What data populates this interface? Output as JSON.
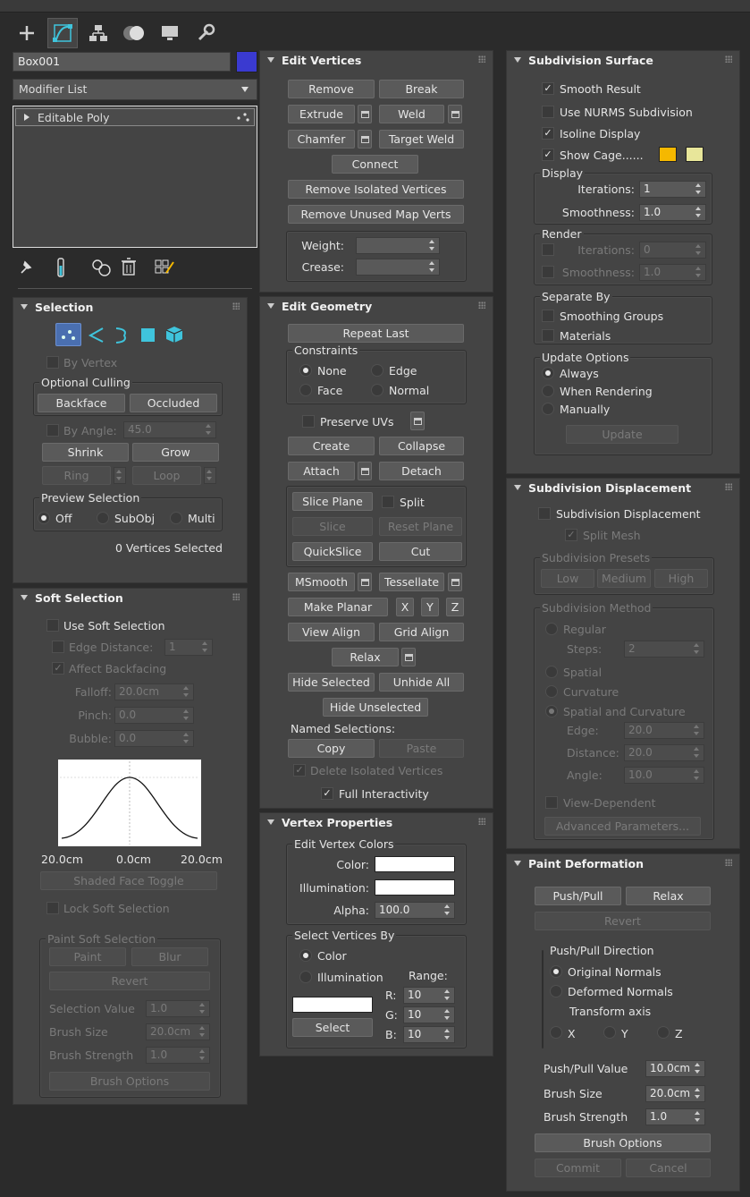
{
  "tabs": [
    {
      "name": "create-tab",
      "icon": "plus-icon"
    },
    {
      "name": "modify-tab",
      "icon": "modify-icon"
    },
    {
      "name": "hierarchy-tab",
      "icon": "hierarchy-icon"
    },
    {
      "name": "motion-tab",
      "icon": "motion-icon"
    },
    {
      "name": "display-tab",
      "icon": "display-icon"
    },
    {
      "name": "utilities-tab",
      "icon": "wrench-icon"
    }
  ],
  "object": {
    "name": "Box001",
    "color": "#3a3ad0"
  },
  "modifier_list": {
    "label": "Modifier List",
    "stack_item": "Editable Poly"
  },
  "selection": {
    "title": "Selection",
    "by_vertex": "By Vertex",
    "optional_culling": "Optional Culling",
    "backface": "Backface",
    "occluded": "Occluded",
    "by_angle": "By Angle:",
    "angle_value": "45.0",
    "shrink": "Shrink",
    "grow": "Grow",
    "ring": "Ring",
    "loop": "Loop",
    "preview_selection": "Preview Selection",
    "off": "Off",
    "subobj": "SubObj",
    "multi": "Multi",
    "status": "0 Vertices Selected"
  },
  "soft_selection": {
    "title": "Soft Selection",
    "use_soft": "Use Soft Selection",
    "edge_distance": "Edge Distance:",
    "edge_distance_value": "1",
    "affect_backfacing": "Affect Backfacing",
    "falloff": "Falloff:",
    "falloff_value": "20.0cm",
    "pinch": "Pinch:",
    "pinch_value": "0.0",
    "bubble": "Bubble:",
    "bubble_value": "0.0",
    "curve_left": "20.0cm",
    "curve_mid": "0.0cm",
    "curve_right": "20.0cm",
    "shaded_face_toggle": "Shaded Face Toggle",
    "lock_soft": "Lock Soft Selection",
    "paint_soft": "Paint Soft Selection",
    "paint": "Paint",
    "blur": "Blur",
    "revert": "Revert",
    "selection_value": "Selection Value",
    "selection_value_v": "1.0",
    "brush_size": "Brush Size",
    "brush_size_v": "20.0cm",
    "brush_strength": "Brush Strength",
    "brush_strength_v": "1.0",
    "brush_options": "Brush Options"
  },
  "edit_vertices": {
    "title": "Edit Vertices",
    "remove": "Remove",
    "break": "Break",
    "extrude": "Extrude",
    "weld": "Weld",
    "chamfer": "Chamfer",
    "target_weld": "Target Weld",
    "connect": "Connect",
    "remove_isolated": "Remove Isolated Vertices",
    "remove_unused": "Remove Unused Map Verts",
    "weight": "Weight:",
    "crease": "Crease:"
  },
  "edit_geometry": {
    "title": "Edit Geometry",
    "repeat_last": "Repeat Last",
    "constraints": "Constraints",
    "none": "None",
    "edge": "Edge",
    "face": "Face",
    "normal": "Normal",
    "preserve_uvs": "Preserve UVs",
    "create": "Create",
    "collapse": "Collapse",
    "attach": "Attach",
    "detach": "Detach",
    "slice_plane": "Slice Plane",
    "split": "Split",
    "slice": "Slice",
    "reset_plane": "Reset Plane",
    "quickslice": "QuickSlice",
    "cut": "Cut",
    "msmooth": "MSmooth",
    "tessellate": "Tessellate",
    "make_planar": "Make Planar",
    "x": "X",
    "y": "Y",
    "z": "Z",
    "view_align": "View Align",
    "grid_align": "Grid Align",
    "relax": "Relax",
    "hide_selected": "Hide Selected",
    "unhide_all": "Unhide All",
    "hide_unselected": "Hide Unselected",
    "named_selections": "Named Selections:",
    "copy": "Copy",
    "paste": "Paste",
    "delete_isolated": "Delete Isolated Vertices",
    "full_interactivity": "Full Interactivity"
  },
  "vertex_properties": {
    "title": "Vertex Properties",
    "edit_vertex_colors": "Edit Vertex Colors",
    "color": "Color:",
    "illumination": "Illumination:",
    "alpha": "Alpha:",
    "alpha_value": "100.0",
    "select_vertices_by": "Select Vertices By",
    "color_opt": "Color",
    "illumination_opt": "Illumination",
    "range": "Range:",
    "r": "R:",
    "g": "G:",
    "b": "B:",
    "r_v": "10",
    "g_v": "10",
    "b_v": "10",
    "select": "Select"
  },
  "subdivision_surface": {
    "title": "Subdivision Surface",
    "smooth_result": "Smooth Result",
    "use_nurms": "Use NURMS Subdivision",
    "isoline_display": "Isoline Display",
    "show_cage": "Show Cage......",
    "cage_color1": "#f5b800",
    "cage_color2": "#e8e69a",
    "display": "Display",
    "iterations": "Iterations:",
    "iterations_v": "1",
    "smoothness": "Smoothness:",
    "smoothness_v": "1.0",
    "render": "Render",
    "r_iterations_v": "0",
    "r_smoothness_v": "1.0",
    "separate_by": "Separate By",
    "smoothing_groups": "Smoothing Groups",
    "materials": "Materials",
    "update_options": "Update Options",
    "always": "Always",
    "when_rendering": "When Rendering",
    "manually": "Manually",
    "update": "Update"
  },
  "subdivision_displacement": {
    "title": "Subdivision Displacement",
    "subdiv_disp": "Subdivision Displacement",
    "split_mesh": "Split Mesh",
    "presets": "Subdivision Presets",
    "low": "Low",
    "medium": "Medium",
    "high": "High",
    "method": "Subdivision Method",
    "regular": "Regular",
    "steps": "Steps:",
    "steps_v": "2",
    "spatial": "Spatial",
    "curvature": "Curvature",
    "spatial_curv": "Spatial and Curvature",
    "edge": "Edge:",
    "edge_v": "20.0",
    "distance": "Distance:",
    "distance_v": "20.0",
    "angle": "Angle:",
    "angle_v": "10.0",
    "view_dependent": "View-Dependent",
    "advanced": "Advanced Parameters..."
  },
  "paint_deformation": {
    "title": "Paint Deformation",
    "push_pull": "Push/Pull",
    "relax": "Relax",
    "revert": "Revert",
    "direction": "Push/Pull Direction",
    "original_normals": "Original Normals",
    "deformed_normals": "Deformed Normals",
    "transform_axis": "Transform axis",
    "x": "X",
    "y": "Y",
    "z": "Z",
    "push_pull_value": "Push/Pull Value",
    "push_pull_value_v": "10.0cm",
    "brush_size": "Brush Size",
    "brush_size_v": "20.0cm",
    "brush_strength": "Brush Strength",
    "brush_strength_v": "1.0",
    "brush_options": "Brush Options",
    "commit": "Commit",
    "cancel": "Cancel"
  }
}
